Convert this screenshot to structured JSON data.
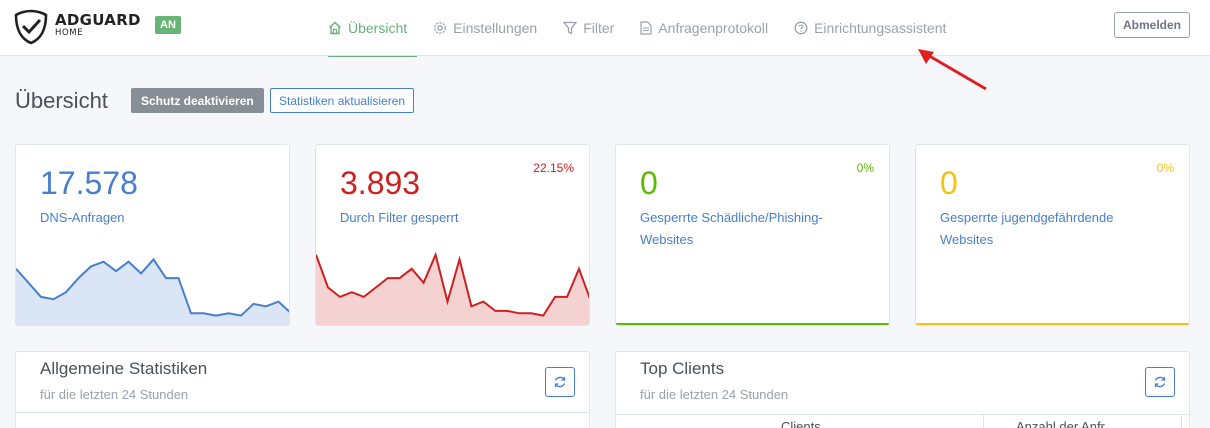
{
  "header": {
    "brand_name": "ADGUARD",
    "brand_sub": "HOME",
    "status_badge": "AN",
    "logout_label": "Abmelden",
    "nav": [
      {
        "label": "Übersicht",
        "icon": "home-icon",
        "active": true
      },
      {
        "label": "Einstellungen",
        "icon": "gear-icon",
        "active": false
      },
      {
        "label": "Filter",
        "icon": "filter-icon",
        "active": false
      },
      {
        "label": "Anfragenprotokoll",
        "icon": "document-icon",
        "active": false
      },
      {
        "label": "Einrichtungsassistent",
        "icon": "help-circle-icon",
        "active": false
      }
    ]
  },
  "page": {
    "title": "Übersicht",
    "disable_protection_label": "Schutz deaktivieren",
    "refresh_stats_label": "Statistiken aktualisieren"
  },
  "cards": [
    {
      "value": "17.578",
      "label": "DNS-Anfragen",
      "percent": "",
      "color": "#467fcf"
    },
    {
      "value": "3.893",
      "label": "Durch Filter gesperrt",
      "percent": "22.15%",
      "color": "#cd201f"
    },
    {
      "value": "0",
      "label": "Gesperrte Schädliche/Phishing-Websites",
      "percent": "0%",
      "color": "#5eba00"
    },
    {
      "value": "0",
      "label": "Gesperrte jugendgefährdende Websites",
      "percent": "0%",
      "color": "#f1c40f"
    }
  ],
  "sparklines": {
    "dns_queries": [
      12,
      9,
      6,
      5.5,
      7,
      10,
      12.5,
      13.5,
      11.5,
      13.5,
      11,
      14,
      10,
      10,
      2.5,
      2.5,
      2,
      2.5,
      2,
      4.5,
      4,
      5,
      2.5
    ],
    "blocked": [
      15,
      8,
      6,
      7,
      6,
      8,
      10,
      10,
      12,
      9,
      15,
      5,
      14,
      4,
      5,
      3,
      3,
      2.5,
      2.5,
      2,
      6,
      6,
      12,
      5
    ]
  },
  "colors": {
    "accent_green": "#67b279",
    "primary_blue": "#467fcf",
    "arrow_red": "#e02020"
  },
  "panels": {
    "general": {
      "title": "Allgemeine Statistiken",
      "subtitle": "für die letzten 24 Stunden"
    },
    "clients": {
      "title": "Top Clients",
      "subtitle": "für die letzten 24 Stunden",
      "col_client": "Clients",
      "col_requests": "Anzahl der Anfr"
    }
  }
}
